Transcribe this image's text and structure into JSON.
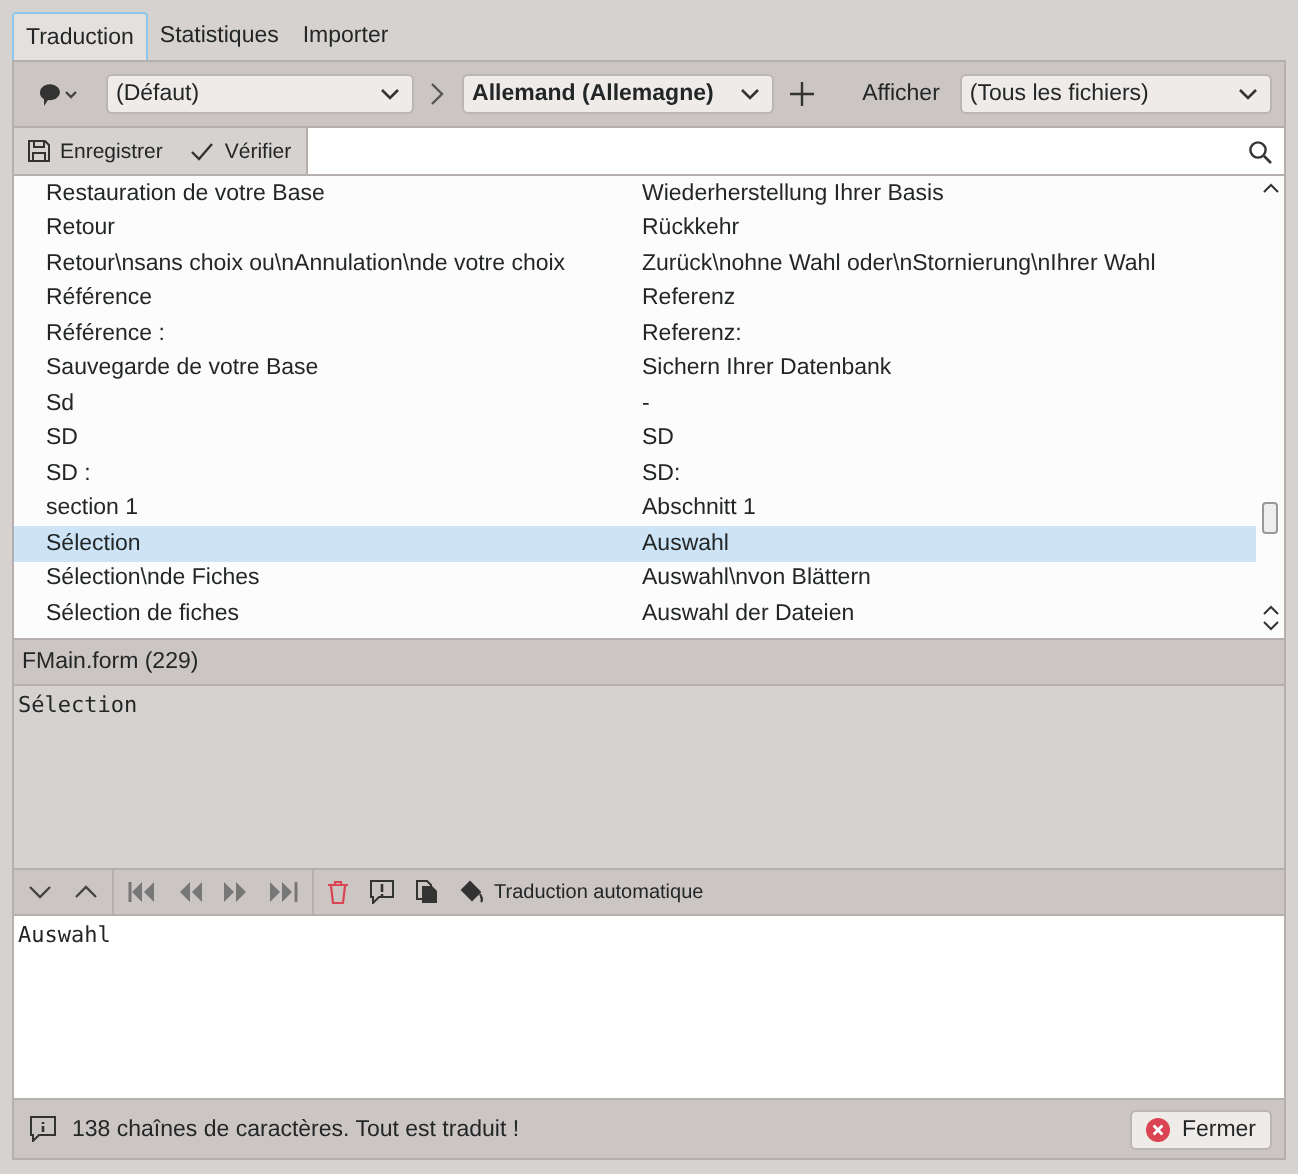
{
  "tabs": [
    {
      "label": "Traduction",
      "selected": true
    },
    {
      "label": "Statistiques",
      "selected": false
    },
    {
      "label": "Importer",
      "selected": false
    }
  ],
  "toolbar": {
    "project": "(Défaut)",
    "language": "Allemand (Allemagne)",
    "show_label": "Afficher",
    "filter": "(Tous les fichiers)"
  },
  "actions": [
    {
      "label": "Enregistrer",
      "kind": "save"
    },
    {
      "label": "Vérifier",
      "kind": "check"
    }
  ],
  "rows": [
    {
      "source": "Restauration de votre Base",
      "translation": "Wiederherstellung Ihrer Basis",
      "selected": false
    },
    {
      "source": "Retour",
      "translation": "Rückkehr",
      "selected": false
    },
    {
      "source": "Retour\\nsans choix ou\\nAnnulation\\nde votre choix",
      "translation": "Zurück\\nohne Wahl oder\\nStornierung\\nIhrer Wahl",
      "selected": false
    },
    {
      "source": "Référence",
      "translation": "Referenz",
      "selected": false
    },
    {
      "source": "Référence :",
      "translation": "Referenz:",
      "selected": false
    },
    {
      "source": "Sauvegarde de votre Base",
      "translation": "Sichern Ihrer Datenbank",
      "selected": false
    },
    {
      "source": "Sd",
      "translation": "-",
      "selected": false
    },
    {
      "source": "SD",
      "translation": "SD",
      "selected": false
    },
    {
      "source": "SD :",
      "translation": "SD:",
      "selected": false
    },
    {
      "source": "section 1",
      "translation": "Abschnitt 1",
      "selected": false
    },
    {
      "source": "Sélection",
      "translation": "Auswahl",
      "selected": true
    },
    {
      "source": "Sélection\\nde Fiches",
      "translation": "Auswahl\\nvon Blättern",
      "selected": false
    },
    {
      "source": "Sélection de fiches",
      "translation": "Auswahl der Dateien",
      "selected": false
    }
  ],
  "context": "FMain.form (229)",
  "source_text": "Sélection",
  "auto_translate": "Traduction automatique",
  "translation_text": "Auswahl",
  "status": "138 chaînes de caractères. Tout est traduit !",
  "close_button": "Fermer"
}
